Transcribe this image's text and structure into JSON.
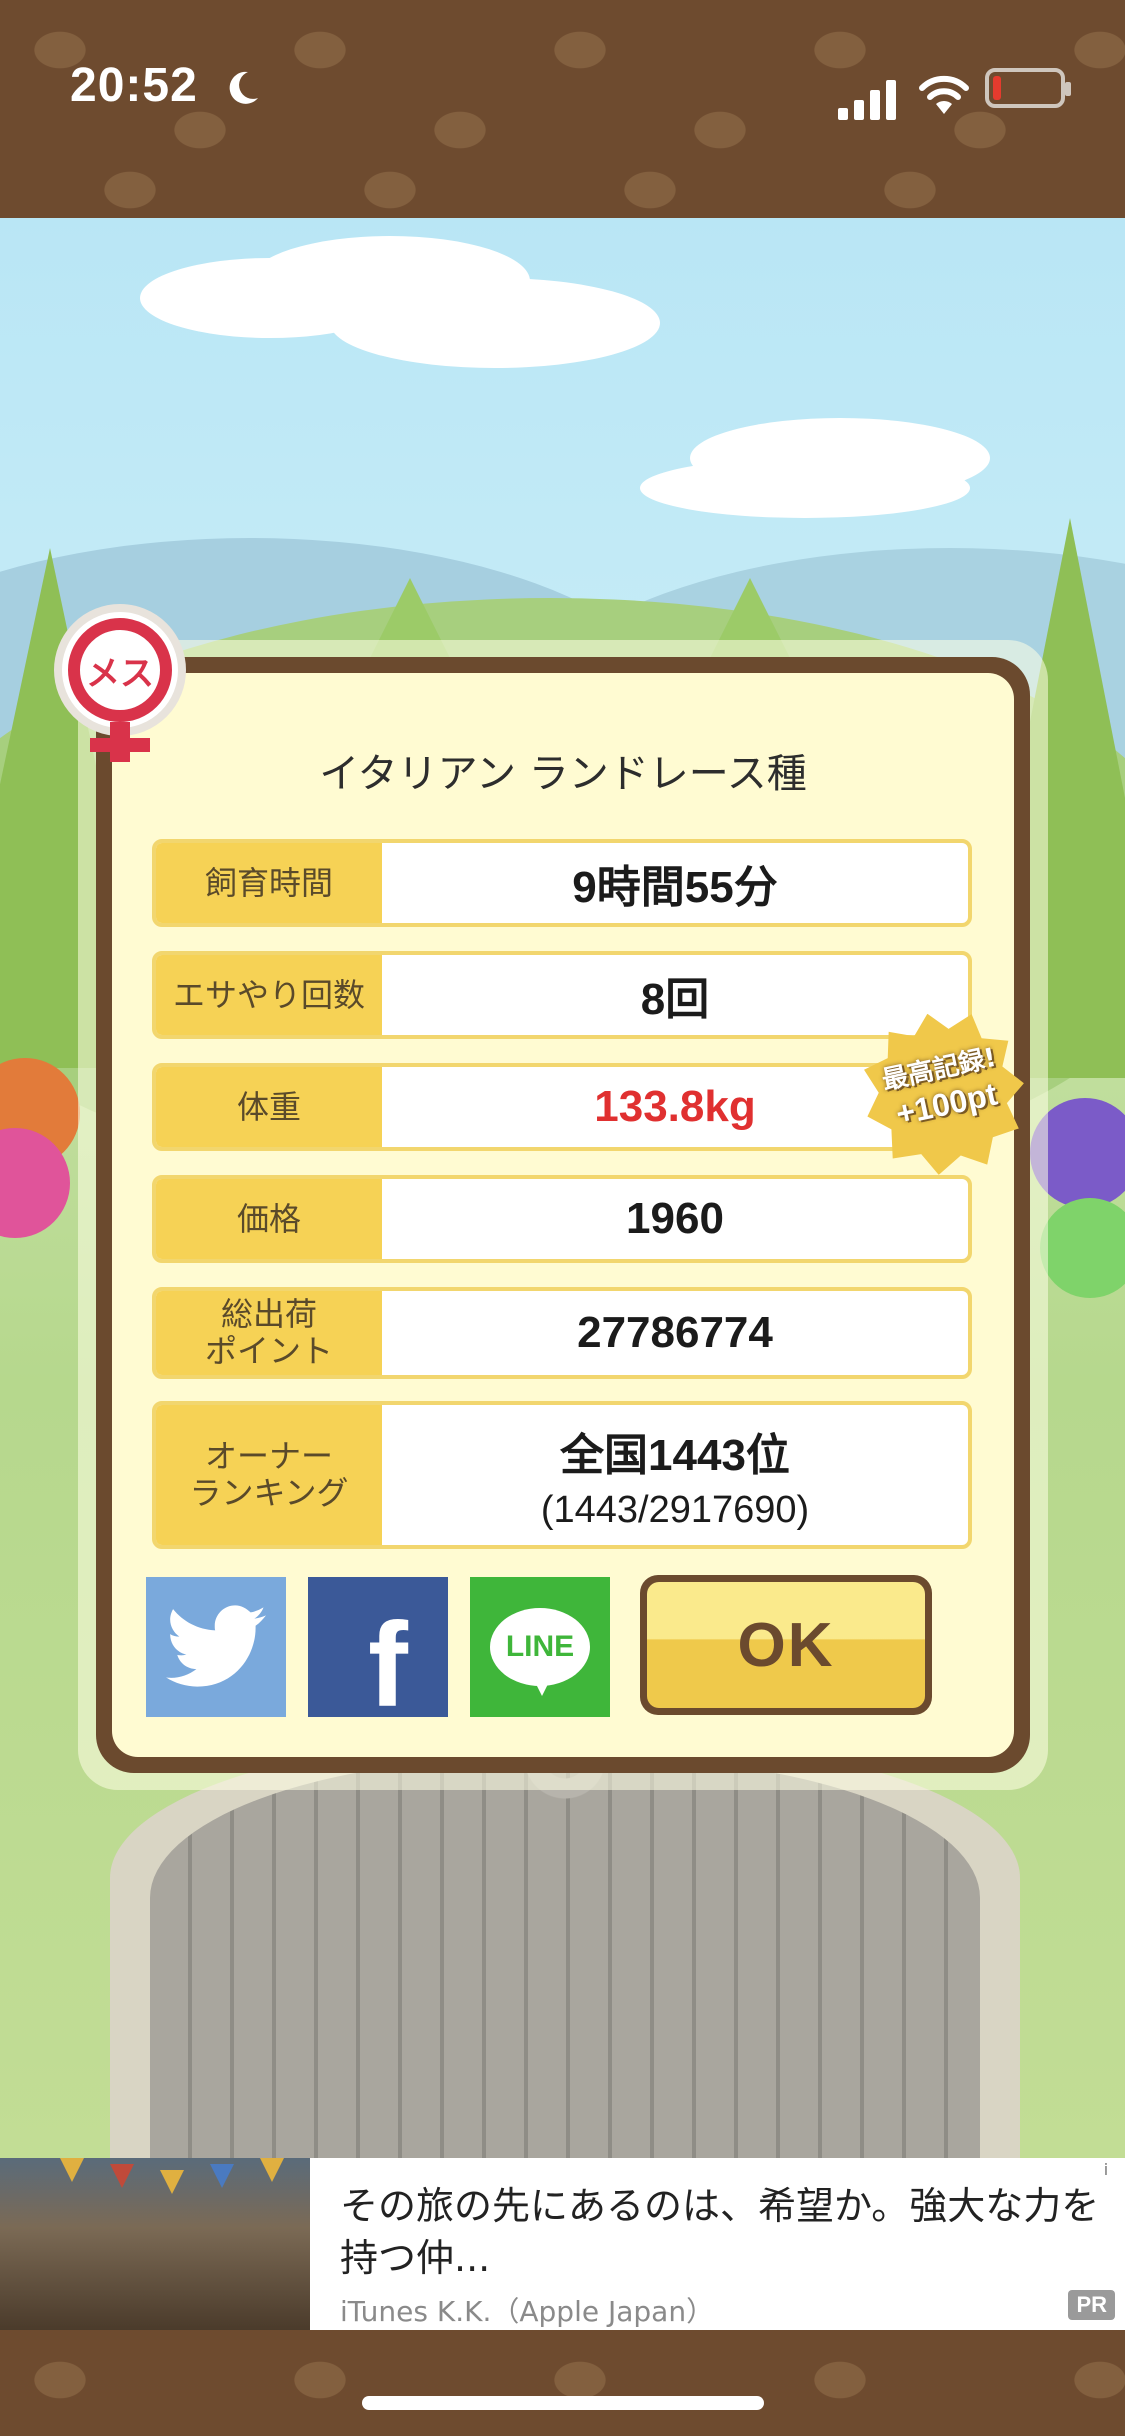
{
  "status_bar": {
    "time": "20:52",
    "icons": [
      "moon-icon",
      "signal-icon",
      "wifi-icon",
      "battery-icon"
    ],
    "battery_color": "#e53b2e"
  },
  "dialog": {
    "gender_badge": "メス",
    "breed": "イタリアン ランドレース種",
    "stats": [
      {
        "label": "飼育時間",
        "value": "9時間55分"
      },
      {
        "label": "エサやり回数",
        "value": "8回"
      },
      {
        "label": "体重",
        "value": "133.8kg"
      },
      {
        "label": "価格",
        "value": "1960"
      },
      {
        "label": "総出荷\nポイント",
        "value": "27786774"
      },
      {
        "label": "オーナー\nランキング",
        "value": "全国1443位",
        "sub": "(1443/2917690)"
      }
    ],
    "record_badge": {
      "text": "最高記録!",
      "points": "+100pt"
    },
    "share_buttons": [
      "twitter-icon",
      "facebook-icon",
      "line-icon"
    ],
    "line_label": "LINE",
    "facebook_letter": "f",
    "ok_label": "OK"
  },
  "ad": {
    "headline": "その旅の先にあるのは、希望か。強大な力を持つ仲...",
    "source": "iTunes K.K.（Apple Japan）",
    "info_icon": "i",
    "pr_label": "PR"
  },
  "colors": {
    "brown": "#6b4a2e",
    "label_yellow": "#f6d255",
    "dialog_bg": "#fffbd2",
    "record_red": "#e03030"
  }
}
